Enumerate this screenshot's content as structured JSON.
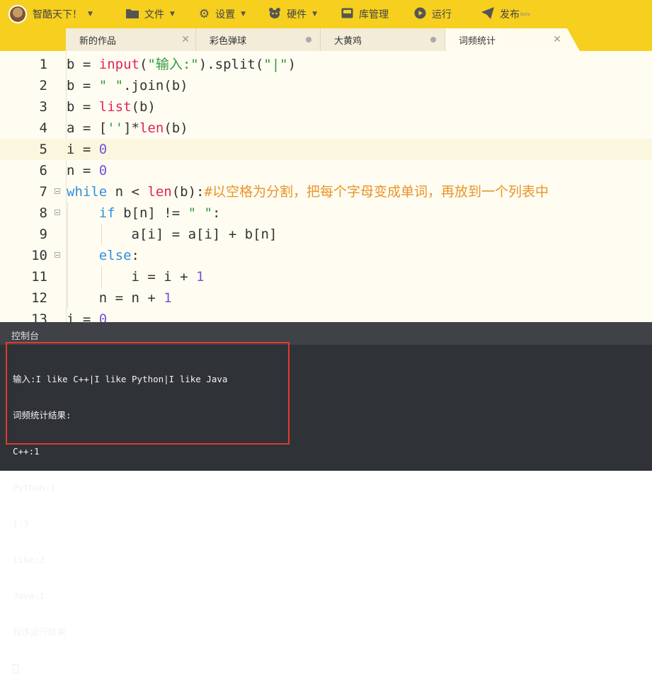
{
  "toolbar": {
    "user_label": "智酷天下！",
    "file_label": "文件",
    "settings_label": "设置",
    "hardware_label": "硬件",
    "library_label": "库管理",
    "run_label": "运行",
    "publish_label": "发布",
    "publish_badge": "Beta"
  },
  "tabs": [
    {
      "label": "新的作品",
      "state": "close"
    },
    {
      "label": "彩色弹球",
      "state": "dot"
    },
    {
      "label": "大黄鸡",
      "state": "dot"
    },
    {
      "label": "词频统计",
      "state": "close-active"
    }
  ],
  "editor": {
    "line_numbers": [
      "1",
      "2",
      "3",
      "4",
      "5",
      "6",
      "7",
      "8",
      "9",
      "10",
      "11",
      "12",
      "13"
    ],
    "highlighted_line": "5"
  },
  "console": {
    "title": "控制台",
    "lines": [
      "输入:I like C++|I like Python|I like Java",
      "词频统计结果:",
      "C++:1",
      "Python:1",
      "I:3",
      "like:3",
      "Java:1",
      "程序运行结束"
    ]
  },
  "colors": {
    "toolbar_bg": "#f6cf1f",
    "keyword": "#2f8fe3",
    "builtin": "#e0245e",
    "string": "#2e9b3e",
    "number": "#7057d6",
    "comment": "#e99329",
    "console_bg": "#2f3237",
    "highlight_box": "#e03a2e"
  }
}
